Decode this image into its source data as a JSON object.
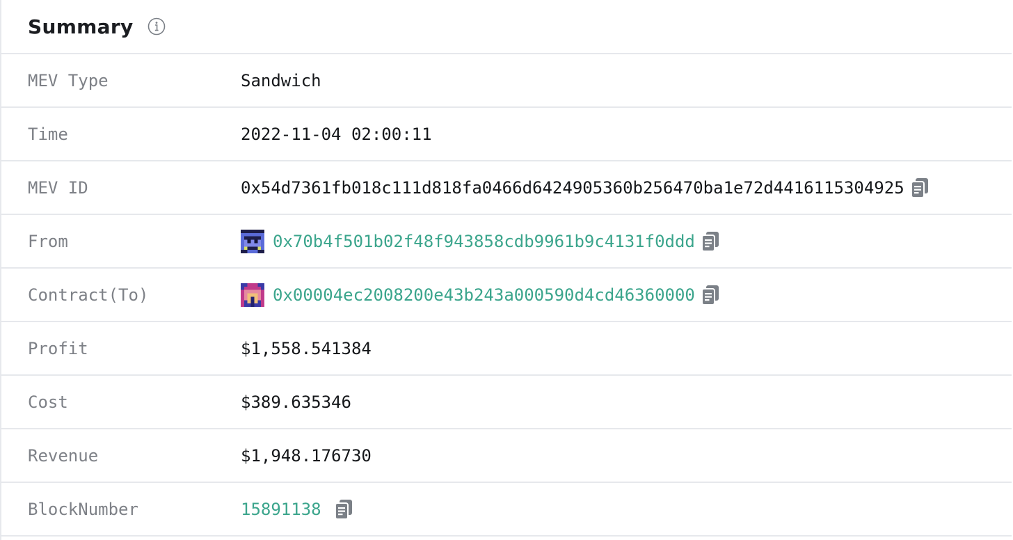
{
  "summary": {
    "title": "Summary",
    "rows": {
      "mev_type": {
        "label": "MEV Type",
        "value": "Sandwich"
      },
      "time": {
        "label": "Time",
        "value": "2022-11-04 02:00:11"
      },
      "mev_id": {
        "label": "MEV ID",
        "value": "0x54d7361fb018c111d818fa0466d6424905360b256470ba1e72d4416115304925"
      },
      "from": {
        "label": "From",
        "value": "0x70b4f501b02f48f943858cdb9961b9c4131f0ddd"
      },
      "contract_to": {
        "label": "Contract(To)",
        "value": "0x00004ec2008200e43b243a000590d4cd46360000"
      },
      "profit": {
        "label": "Profit",
        "value": "$1,558.541384"
      },
      "cost": {
        "label": "Cost",
        "value": "$389.635346"
      },
      "revenue": {
        "label": "Revenue",
        "value": "$1,948.176730"
      },
      "block_number": {
        "label": "BlockNumber",
        "value": "15891138"
      }
    }
  },
  "icons": {
    "info": "info-icon",
    "copy": "copy-icon",
    "avatar_from": "identicon-avatar",
    "avatar_contract": "identicon-avatar"
  },
  "colors": {
    "link": "#3ba58c",
    "label": "#7e8187",
    "value": "#15171a",
    "divider": "#e6e8ec",
    "icon": "#7b8087"
  }
}
